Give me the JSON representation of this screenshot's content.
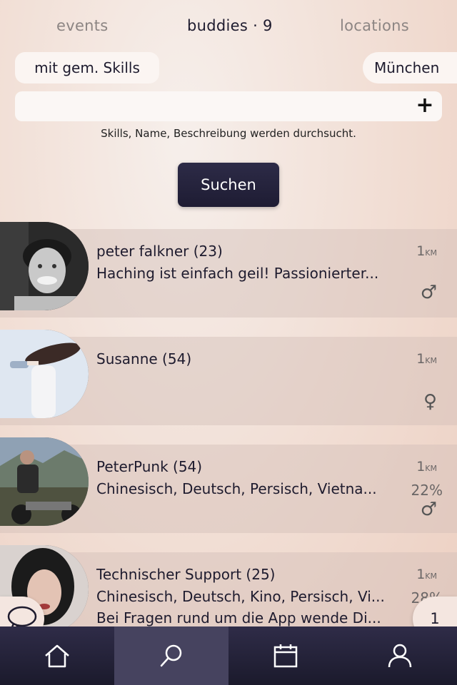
{
  "tabs": [
    {
      "label": "events",
      "active": false
    },
    {
      "label": "buddies · 9",
      "active": true
    },
    {
      "label": "locations",
      "active": false
    }
  ],
  "filters": {
    "skills_chip": "mit gem. Skills",
    "city_chip": "München"
  },
  "search": {
    "value": "",
    "placeholder": "",
    "hint": "Skills, Name, Beschreibung werden durchsucht.",
    "button": "Suchen",
    "add_icon": "plus-icon"
  },
  "buddies": [
    {
      "name": "peter falkner (23)",
      "line1": "Haching ist einfach geil! Passionierter...",
      "line2": "",
      "distance": "1",
      "unit": "KM",
      "match": "",
      "gender": "♂"
    },
    {
      "name": "Susanne (54)",
      "line1": "",
      "line2": "",
      "distance": "1",
      "unit": "KM",
      "match": "",
      "gender": "♀"
    },
    {
      "name": "PeterPunk (54)",
      "line1": "Chinesisch, Deutsch, Persisch, Vietna...",
      "line2": "",
      "distance": "1",
      "unit": "KM",
      "match": "22%",
      "gender": "♂"
    },
    {
      "name": "Technischer Support (25)",
      "line1": "Chinesisch, Deutsch, Kino, Persisch, Vi...",
      "line2": "Bei Fragen rund um die App wende Di...",
      "distance": "1",
      "unit": "KM",
      "match": "28%",
      "gender": ""
    }
  ],
  "fab": {
    "chat_icon": "chat-bubble-icon",
    "count": "1"
  },
  "nav": [
    {
      "icon": "home-icon",
      "active": false
    },
    {
      "icon": "search-icon",
      "active": true
    },
    {
      "icon": "calendar-icon",
      "active": false
    },
    {
      "icon": "profile-icon",
      "active": false
    }
  ]
}
